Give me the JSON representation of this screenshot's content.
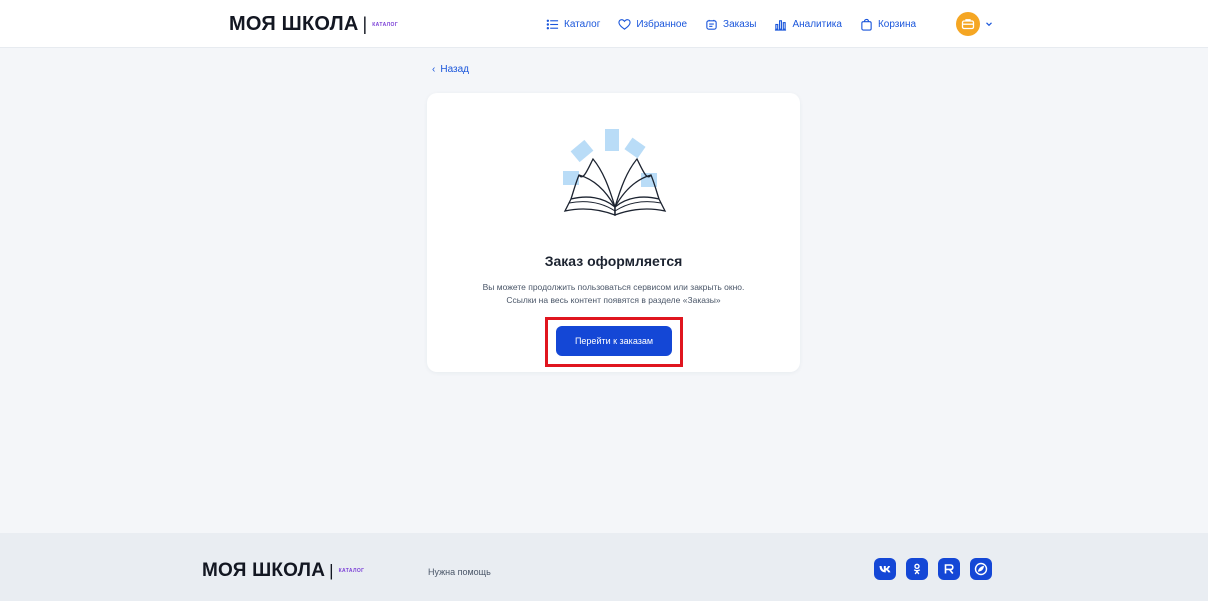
{
  "header": {
    "logo": {
      "main": "МОЯ ШКОЛА",
      "separator": "|",
      "tag": "КАТАЛОГ"
    },
    "nav": [
      {
        "label": "Каталог",
        "icon": "list-icon"
      },
      {
        "label": "Избранное",
        "icon": "heart-icon"
      },
      {
        "label": "Заказы",
        "icon": "orders-icon"
      },
      {
        "label": "Аналитика",
        "icon": "chart-icon"
      },
      {
        "label": "Корзина",
        "icon": "bag-icon"
      }
    ],
    "avatar_icon": "briefcase-icon"
  },
  "back": {
    "label": "Назад"
  },
  "card": {
    "title": "Заказ оформляется",
    "text_line1": "Вы можете продолжить пользоваться сервисом или закрыть окно.",
    "text_line2": "Ссылки на весь контент появятся в разделе «Заказы»",
    "button_label": "Перейти к заказам"
  },
  "footer": {
    "logo": {
      "main": "МОЯ ШКОЛА",
      "separator": "|",
      "tag": "КАТАЛОГ"
    },
    "help": "Нужна помощь",
    "social": [
      "vk-icon",
      "ok-icon",
      "rutube-icon",
      "sferum-icon"
    ]
  },
  "colors": {
    "accent": "#1447d6",
    "link": "#1a56db",
    "highlight": "#e0151f",
    "avatar": "#f5a623",
    "logo_tag": "#7a3ed6"
  }
}
